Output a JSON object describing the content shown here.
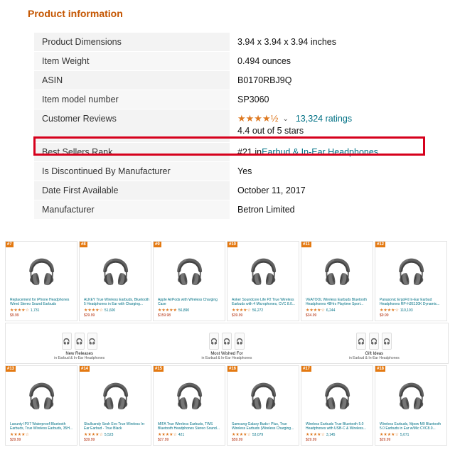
{
  "title": "Product information",
  "rows": [
    {
      "key": "Product Dimensions",
      "value": "3.94 x 3.94 x 3.94 inches"
    },
    {
      "key": "Item Weight",
      "value": "0.494 ounces"
    },
    {
      "key": "ASIN",
      "value": "B0170RBJ9Q"
    },
    {
      "key": "Item model number",
      "value": "SP3060"
    }
  ],
  "reviews": {
    "key": "Customer Reviews",
    "stars": "★★★★½",
    "ratings_link": "13,324 ratings",
    "summary": "4.4 out of 5 stars"
  },
  "rank": {
    "key": "Best Sellers Rank",
    "prefix": "#21 in ",
    "link": "Earbud & In-Ear Headphones"
  },
  "rows2": [
    {
      "key": "Is Discontinued By Manufacturer",
      "value": "Yes"
    },
    {
      "key": "Date First Available",
      "value": "October 11, 2017"
    },
    {
      "key": "Manufacturer",
      "value": "Betron Limited"
    }
  ],
  "cards_top": [
    {
      "badge": "#7",
      "name": "Replacement for iPhone Headphones Wired Stereo Sound Earbuds",
      "stars": "★★★★☆",
      "count": "1,731",
      "price": "$9.99",
      "icon": "🎧"
    },
    {
      "badge": "#8",
      "name": "ALKEY True Wireless Earbuds, Bluetooth 5 Headphones in Ear with Charging...",
      "stars": "★★★★☆",
      "count": "51,600",
      "price": "$29.99",
      "icon": "🎧"
    },
    {
      "badge": "#9",
      "name": "Apple AirPods with Wireless Charging Case",
      "stars": "★★★★★",
      "count": "56,890",
      "price": "$159.98",
      "icon": "🎧"
    },
    {
      "badge": "#10",
      "name": "Anker Soundcore Life P2 True Wireless Earbuds with 4 Microphones, CVC 8.0...",
      "stars": "★★★★☆",
      "count": "56,272",
      "price": "$39.99",
      "icon": "🎧"
    },
    {
      "badge": "#11",
      "name": "VEATOOL Wireless Earbuds Bluetooth Headphones 48Hrs Playtime Sport...",
      "stars": "★★★★☆",
      "count": "6,244",
      "price": "$34.99",
      "icon": "🎧"
    },
    {
      "badge": "#12",
      "name": "Panasonic ErgoFit In-Ear Earbud Headphones RP-HJE120K Dynamic...",
      "stars": "★★★★☆",
      "count": "110,193",
      "price": "$9.99",
      "icon": "🎧"
    }
  ],
  "mid": [
    {
      "label": "New Releases",
      "sub": "in Earbud & In-Ear Headphones"
    },
    {
      "label": "Most Wished For",
      "sub": "in Earbud & In-Ear Headphones"
    },
    {
      "label": "Gift Ideas",
      "sub": "in Earbud & In-Ear Headphones"
    }
  ],
  "cards_bottom": [
    {
      "badge": "#13",
      "name": "Laounty IPX7 Waterproof Bluetooth Earbuds, True Wireless Earbuds, 35H...",
      "stars": "★★★★☆",
      "count": "",
      "price": "$29.99",
      "icon": "🎧"
    },
    {
      "badge": "#14",
      "name": "Skullcandy Sesh Evo True Wireless In-Ear Earbud - True Black",
      "stars": "★★★★☆",
      "count": "5,523",
      "price": "$39.99",
      "icon": "🎧"
    },
    {
      "badge": "#15",
      "name": "MIFA True Wireless Earbuds, TWS Bluetooth Headphones Stereo Sound...",
      "stars": "★★★★☆",
      "count": "421",
      "price": "$27.99",
      "icon": "🎧"
    },
    {
      "badge": "#16",
      "name": "Samsung Galaxy Buds+ Plus, True Wireless Earbuds (Wireless Charging...",
      "stars": "★★★★☆",
      "count": "53,079",
      "price": "$59.99",
      "icon": "🎧"
    },
    {
      "badge": "#17",
      "name": "Wireless Earbuds True Bluetooth 5.0 Headphones with USB-C & Wireless...",
      "stars": "★★★★☆",
      "count": "3,145",
      "price": "$29.99",
      "icon": "🎧"
    },
    {
      "badge": "#18",
      "name": "Wireless Earbuds, Mpow M9 Bluetooth 5.0 Earbuds in Ear w/Mic CVC8.0...",
      "stars": "★★★★☆",
      "count": "5,071",
      "price": "$29.99",
      "icon": "🎧"
    }
  ]
}
